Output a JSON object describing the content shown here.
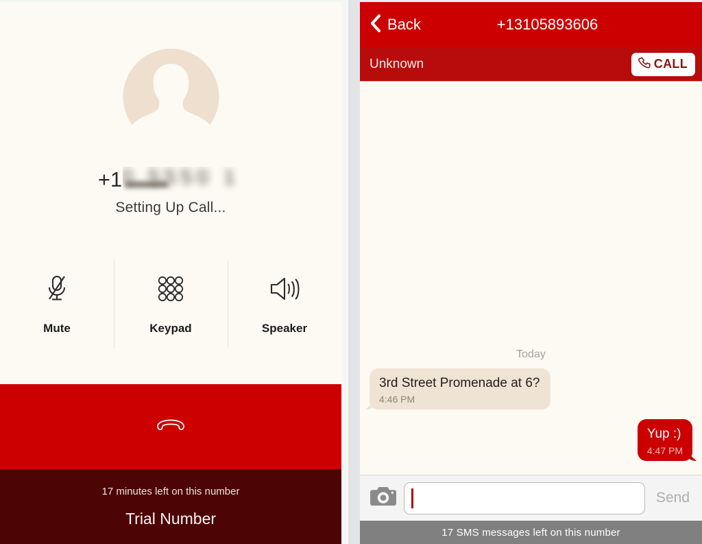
{
  "call_screen": {
    "avatar_icon": "person-avatar-icon",
    "country_code": "+1",
    "number_redacted": "0 5550 1 2 3 4 5",
    "status": "Setting Up Call...",
    "controls": [
      {
        "label": "Mute",
        "icon": "microphone-muted-icon"
      },
      {
        "label": "Keypad",
        "icon": "keypad-dots-icon"
      },
      {
        "label": "Speaker",
        "icon": "speaker-waves-icon"
      }
    ],
    "end_call_icon": "end-call-handset-icon",
    "minutes_left": "17 minutes left on this number",
    "plan_name": "Trial Number",
    "colors": {
      "background": "#fdfaf4",
      "end_call_red": "#cc0000",
      "trial_bar": "#4d0404",
      "avatar": "#eedfce"
    }
  },
  "sms_screen": {
    "nav": {
      "back_label": "Back",
      "back_icon": "chevron-left-icon",
      "title": "+13105893606"
    },
    "subbar": {
      "contact_name": "Unknown",
      "call_button_label": "CALL",
      "call_button_icon": "handset-icon"
    },
    "thread": {
      "day_separator": "Today",
      "messages": [
        {
          "direction": "in",
          "text": "3rd Street Promenade at 6?",
          "time": "4:46 PM"
        },
        {
          "direction": "out",
          "text": "Yup :)",
          "time": "4:47 PM"
        }
      ]
    },
    "composer": {
      "camera_icon": "camera-icon",
      "input_value": "",
      "input_placeholder": "",
      "send_label": "Send"
    },
    "sms_left": "17 SMS messages left on this number",
    "colors": {
      "nav_red": "#cc0000",
      "subbar_red": "#b80c0c",
      "bubble_in": "#efe3d4",
      "bubble_out": "#cc0000",
      "status_bar": "#808080"
    }
  }
}
